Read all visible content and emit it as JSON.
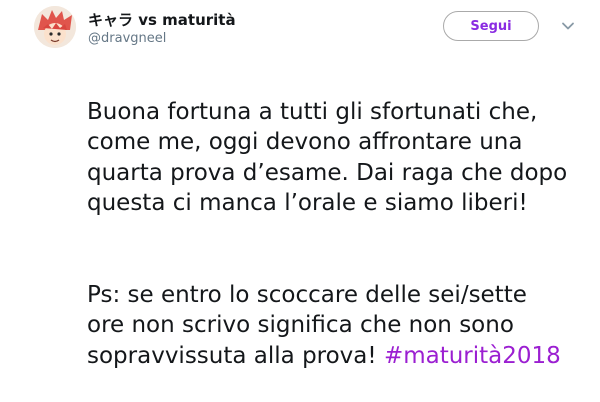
{
  "user": {
    "display_name": "キャラ vs maturità",
    "handle": "@dravgneel"
  },
  "follow_button": {
    "label": "Segui"
  },
  "icons": {
    "avatar": "anime-character-avatar",
    "caret": "chevron-down-icon"
  },
  "colors": {
    "hashtag": "#9b1fd1",
    "follow_text": "#8a2be2",
    "handle": "#657786"
  },
  "tweet": {
    "paragraph1": "Buona fortuna a tutti gli sfortunati che,\ncome me, oggi devono affrontare una\nquarta prova d’esame. Dai raga che dopo\nquesta ci manca l’orale e siamo liberi!",
    "paragraph2": "Ps: se entro lo scoccare delle sei/sette\nore non scrivo significa che non sono\nsopravvissuta alla prova! ",
    "hashtag": "#maturità2018"
  }
}
